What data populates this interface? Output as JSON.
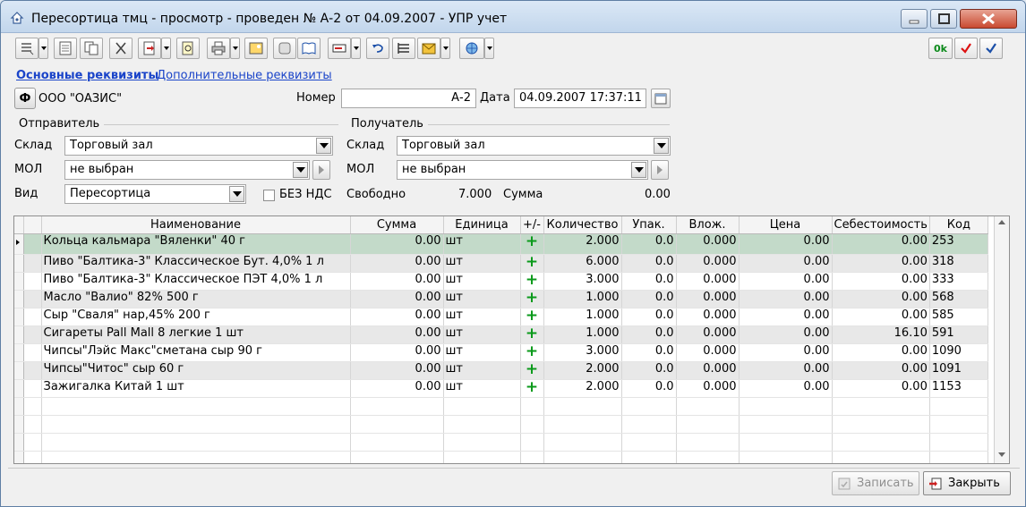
{
  "window": {
    "title": "Пересортица тмц - просмотр - проведен № А-2 от 04.09.2007 - УПР учет"
  },
  "icons": {
    "app": "house-icon",
    "minimize": "minimize-icon",
    "maximize": "maximize-icon",
    "close": "close-icon"
  },
  "toolbar_right": {
    "ok_label": "0k"
  },
  "tabs": {
    "main": "Основные реквизиты",
    "additional": "Дополнительные реквизиты"
  },
  "org": {
    "button_label": "Ф",
    "name": "ООО \"ОАЗИС\""
  },
  "header": {
    "number_label": "Номер",
    "number_value": "А-2",
    "date_label": "Дата",
    "date_value": "04.09.2007 17:37:11"
  },
  "sender": {
    "group_label": "Отправитель",
    "warehouse_label": "Склад",
    "warehouse_value": "Торговый зал",
    "mol_label": "МОЛ",
    "mol_value": "не выбран",
    "kind_label": "Вид",
    "kind_value": "Пересортица",
    "no_vat_label": "БЕЗ НДС"
  },
  "receiver": {
    "group_label": "Получатель",
    "warehouse_label": "Склад",
    "warehouse_value": "Торговый зал",
    "mol_label": "МОЛ",
    "mol_value": "не выбран",
    "free_label": "Свободно",
    "free_value": "7.000",
    "sum_label": "Сумма",
    "sum_value": "0.00"
  },
  "grid": {
    "columns": [
      "Наименование",
      "Сумма",
      "Единица",
      "+/-",
      "Количество",
      "Упак.",
      "Влож.",
      "Цена",
      "Себестоимость",
      "Код"
    ],
    "rows": [
      {
        "name": "Кольца кальмара \"Вяленки\" 40 г",
        "sum": "0.00",
        "unit": "шт",
        "sign": "+",
        "qty": "2.000",
        "pack": "0.0",
        "nested": "0.000",
        "price": "0.00",
        "cost": "0.00",
        "code": "253"
      },
      {
        "name": "Пиво \"Балтика-3\" Классическое Бут. 4,0% 1 л",
        "sum": "0.00",
        "unit": "шт",
        "sign": "+",
        "qty": "6.000",
        "pack": "0.0",
        "nested": "0.000",
        "price": "0.00",
        "cost": "0.00",
        "code": "318"
      },
      {
        "name": "Пиво \"Балтика-3\" Классическое ПЭТ 4,0% 1 л",
        "sum": "0.00",
        "unit": "шт",
        "sign": "+",
        "qty": "3.000",
        "pack": "0.0",
        "nested": "0.000",
        "price": "0.00",
        "cost": "0.00",
        "code": "333"
      },
      {
        "name": "Масло \"Валио\" 82% 500 г",
        "sum": "0.00",
        "unit": "шт",
        "sign": "+",
        "qty": "1.000",
        "pack": "0.0",
        "nested": "0.000",
        "price": "0.00",
        "cost": "0.00",
        "code": "568"
      },
      {
        "name": "Сыр \"Сваля\" нар,45% 200 г",
        "sum": "0.00",
        "unit": "шт",
        "sign": "+",
        "qty": "1.000",
        "pack": "0.0",
        "nested": "0.000",
        "price": "0.00",
        "cost": "0.00",
        "code": "585"
      },
      {
        "name": "Сигареты Pall Mall 8 легкие 1 шт",
        "sum": "0.00",
        "unit": "шт",
        "sign": "+",
        "qty": "1.000",
        "pack": "0.0",
        "nested": "0.000",
        "price": "0.00",
        "cost": "16.10",
        "code": "591"
      },
      {
        "name": "Чипсы\"Лэйс Макс\"сметана сыр 90 г",
        "sum": "0.00",
        "unit": "шт",
        "sign": "+",
        "qty": "3.000",
        "pack": "0.0",
        "nested": "0.000",
        "price": "0.00",
        "cost": "0.00",
        "code": "1090"
      },
      {
        "name": "Чипсы\"Читос\" сыр 60 г",
        "sum": "0.00",
        "unit": "шт",
        "sign": "+",
        "qty": "2.000",
        "pack": "0.0",
        "nested": "0.000",
        "price": "0.00",
        "cost": "0.00",
        "code": "1091"
      },
      {
        "name": "Зажигалка Китай 1 шт",
        "sum": "0.00",
        "unit": "шт",
        "sign": "+",
        "qty": "2.000",
        "pack": "0.0",
        "nested": "0.000",
        "price": "0.00",
        "cost": "0.00",
        "code": "1153"
      }
    ],
    "empty_rows": 5
  },
  "buttons": {
    "save_label": "Записать",
    "close_label": "Закрыть"
  },
  "colors": {
    "link": "#1a44c9",
    "selected_row": "#c3dac9",
    "plus": "#0b9a1b"
  }
}
